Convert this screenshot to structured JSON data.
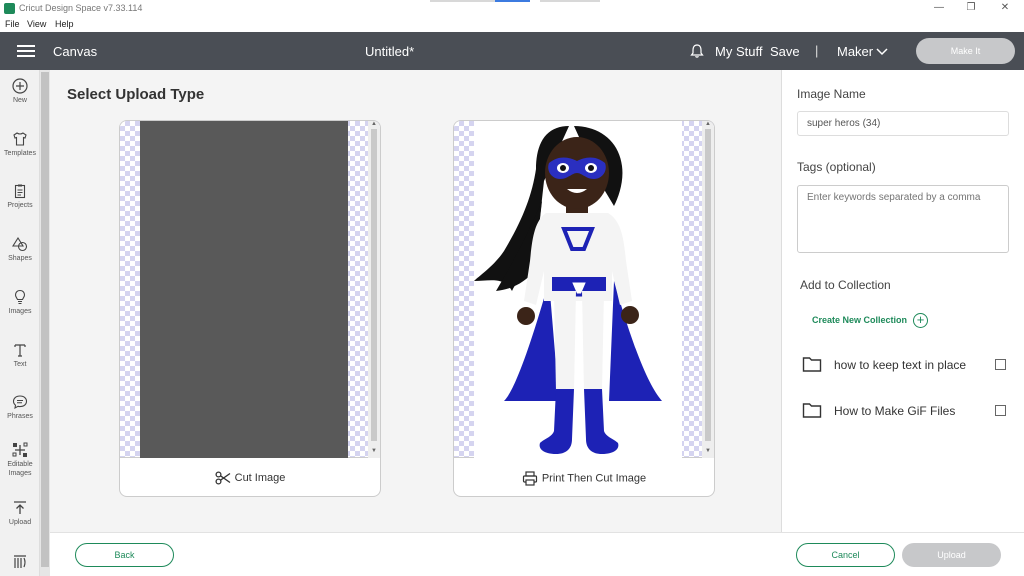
{
  "window": {
    "title": "Cricut Design Space  v7.33.114",
    "minimize": "—",
    "restore": "❐",
    "close": "✕"
  },
  "menu": [
    "File",
    "View",
    "Help"
  ],
  "header": {
    "canvas_label": "Canvas",
    "doc_title": "Untitled*",
    "my_stuff": "My Stuff",
    "save": "Save",
    "separator": "|",
    "machine": "Maker",
    "make_it": "Make It"
  },
  "toolbar": [
    {
      "label": "New",
      "icon": "plus-circle-icon"
    },
    {
      "label": "Templates",
      "icon": "shirt-icon"
    },
    {
      "label": "Projects",
      "icon": "clipboard-icon"
    },
    {
      "label": "Shapes",
      "icon": "shapes-icon"
    },
    {
      "label": "Images",
      "icon": "lightbulb-icon"
    },
    {
      "label": "Text",
      "icon": "text-icon"
    },
    {
      "label": "Phrases",
      "icon": "speech-bubble-icon"
    },
    {
      "label": "Editable Images",
      "icon": "editable-image-icon"
    },
    {
      "label": "Upload",
      "icon": "upload-icon"
    },
    {
      "label": "",
      "icon": "monogram-icon"
    }
  ],
  "main": {
    "heading": "Select Upload Type",
    "cut_option": {
      "label": "Cut Image",
      "icon": "scissors-icon"
    },
    "print_option": {
      "label": "Print Then Cut Image",
      "icon": "printer-icon"
    }
  },
  "panel": {
    "image_name_label": "Image Name",
    "image_name_value": "super heros (34)",
    "tags_label": "Tags (optional)",
    "tags_placeholder": "Enter keywords separated by a comma",
    "add_collection_label": "Add to Collection",
    "create_collection": "Create New Collection",
    "collections": [
      {
        "name": "how to keep text in place",
        "checked": false
      },
      {
        "name": "How to Make GiF Files",
        "checked": false
      }
    ]
  },
  "footer": {
    "back": "Back",
    "cancel": "Cancel",
    "upload": "Upload"
  },
  "colors": {
    "accent": "#1e8a5a",
    "header_bg": "#4a4e55",
    "disabled": "#c7c8ca",
    "checker": "#d5d4f0",
    "costume_blue": "#1d22b5"
  }
}
